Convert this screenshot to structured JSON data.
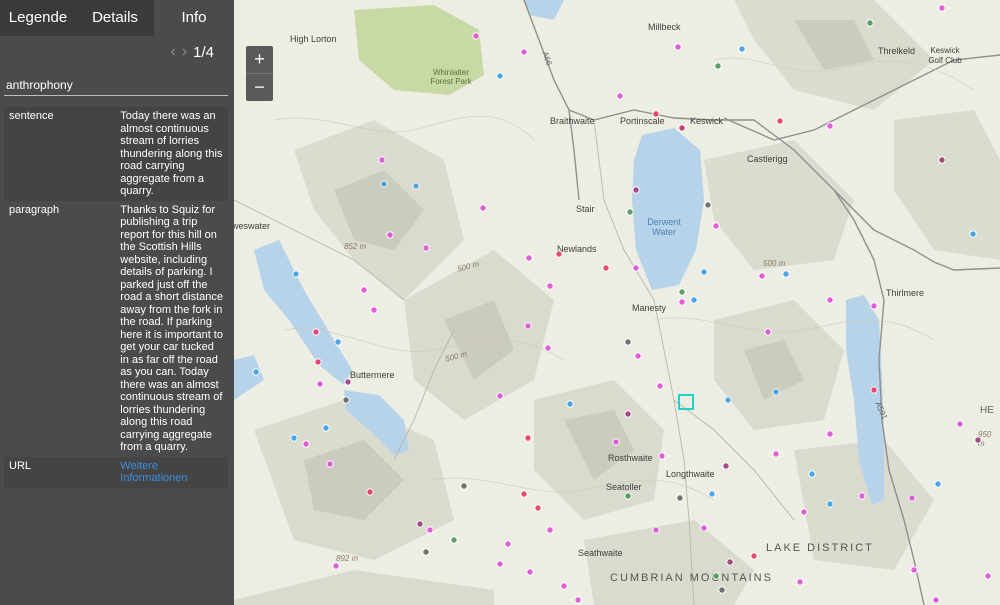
{
  "tabs": {
    "legend": "Legende",
    "details": "Details",
    "info": "Info"
  },
  "collapse_icon": "double-chevron-left",
  "pager": {
    "text": "1/4"
  },
  "feature": {
    "title": "anthrophony",
    "rows": [
      {
        "key": "sentence",
        "value": "Today there was an almost continuous stream of lorries thundering along this road carrying aggregate from a quarry."
      },
      {
        "key": "paragraph",
        "value": "Thanks to Squiz for publishing a trip report for this hill on the Scottish Hills website, including details of parking. I parked just off the road a short distance away from the fork in the road. If parking here it is important to get your car tucked in as far off the road as you can. Today there was an almost continuous stream of lorries thundering along this road carrying aggregate from a quarry."
      },
      {
        "key": "URL",
        "value": "Weitere Informationen"
      }
    ]
  },
  "zoom": {
    "in": "+",
    "out": "−"
  },
  "map": {
    "places": [
      "High Lorton",
      "Millbeck",
      "Threlkeld",
      "Keswick Golf Club",
      "Braithwaite",
      "Portinscale",
      "Keswick",
      "Castlerigg",
      "Stair",
      "Newlands",
      "Manesty",
      "Thirlmere",
      "Buttermere",
      "Rosthwaite",
      "Longthwaite",
      "Seatoller",
      "Seathwaite",
      "weswater",
      "HE"
    ],
    "water": [
      "Derwent Water"
    ],
    "park": [
      "Whinlatter Forest Park"
    ],
    "roads": [
      "A66",
      "A591"
    ],
    "elevations": [
      "852 m",
      "500 m",
      "500 m",
      "500 m",
      "950 m",
      "892 m"
    ],
    "regions": [
      "LAKE DISTRICT",
      "CUMBRIAN MOUNTAINS"
    ]
  },
  "colors": {
    "panel": "#4b4b4b",
    "tabs_inactive": "#3a3a3a",
    "link": "#3b8fe0",
    "selection": "#21d3c6",
    "lake": "#b7d3ea",
    "park": "#c8d9a6"
  }
}
